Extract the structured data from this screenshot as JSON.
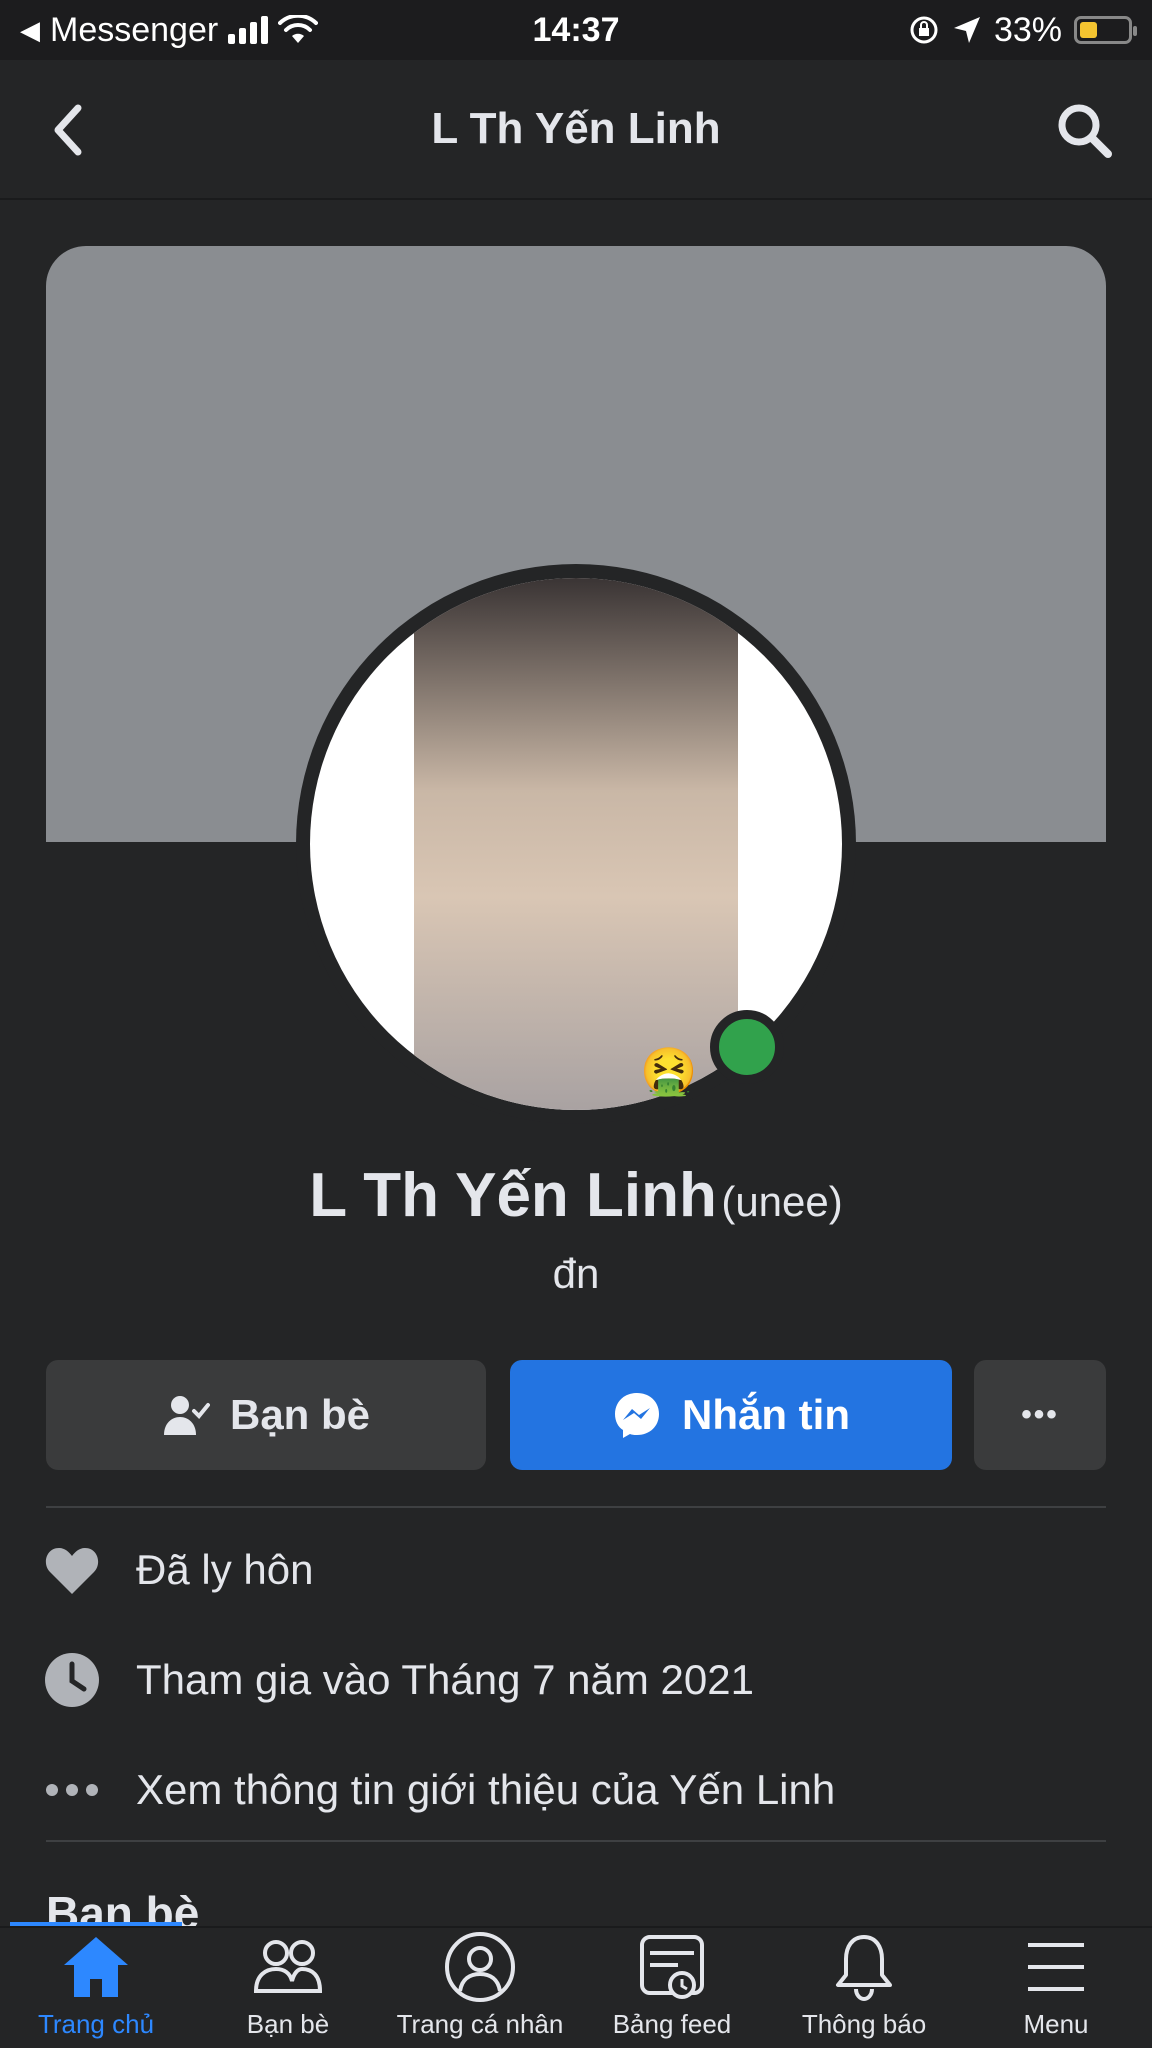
{
  "status_bar": {
    "back_app": "Messenger",
    "time": "14:37",
    "battery": "33%"
  },
  "nav": {
    "title": "L Th Yến Linh"
  },
  "profile": {
    "name": "L Th Yến Linh",
    "alternate_name": "(unee)",
    "bio": "đn",
    "online_status_color": "#31a24c",
    "sticker_emoji": "🤮"
  },
  "actions": {
    "friends_label": "Bạn bè",
    "message_label": "Nhắn tin",
    "more_label": "•••"
  },
  "info": [
    {
      "icon": "heart-icon",
      "text": "Đã ly hôn"
    },
    {
      "icon": "clock-icon",
      "text": "Tham gia vào Tháng 7 năm 2021"
    },
    {
      "icon": "more-dots-icon",
      "text": "Xem thông tin giới thiệu của Yến Linh"
    }
  ],
  "friends_section": {
    "title": "Bạn bè"
  },
  "tabbar": {
    "tabs": [
      {
        "label": "Trang chủ",
        "icon": "home-icon",
        "active": true
      },
      {
        "label": "Bạn bè",
        "icon": "friends-icon",
        "active": false
      },
      {
        "label": "Trang cá nhân",
        "icon": "profile-icon",
        "active": false
      },
      {
        "label": "Bảng feed",
        "icon": "feed-icon",
        "active": false
      },
      {
        "label": "Thông báo",
        "icon": "bell-icon",
        "active": false
      },
      {
        "label": "Menu",
        "icon": "menu-icon",
        "active": false
      }
    ]
  },
  "colors": {
    "background": "#242526",
    "accent": "#2374e1",
    "button_secondary": "#3a3b3c",
    "cover": "#8a8d91"
  }
}
